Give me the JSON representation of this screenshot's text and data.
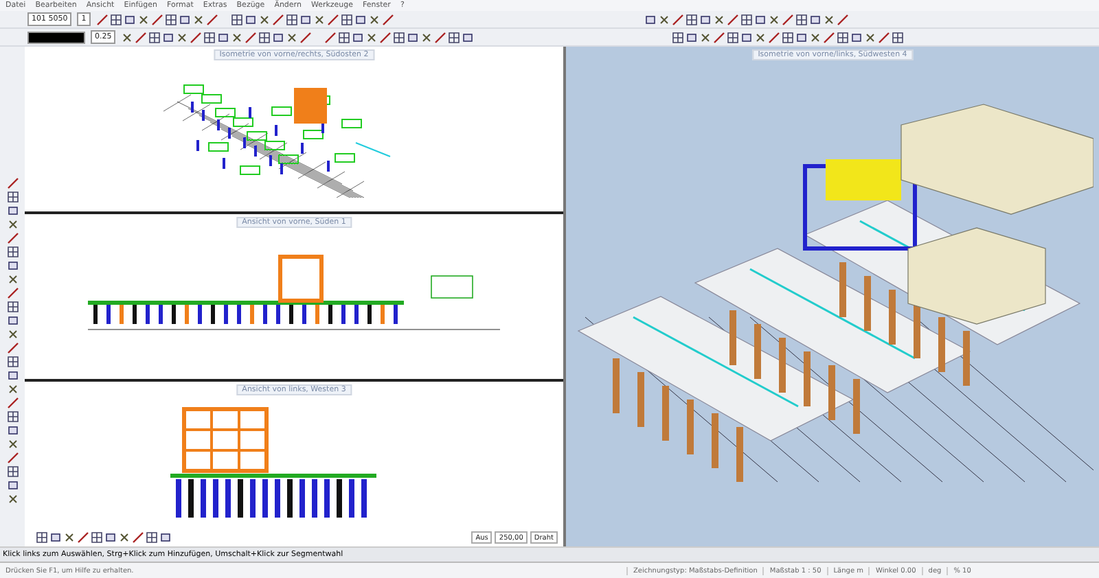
{
  "menu": [
    "Datei",
    "Bearbeiten",
    "Ansicht",
    "Einfügen",
    "Format",
    "Extras",
    "Bezüge",
    "Ändern",
    "Werkzeuge",
    "Fenster",
    "?"
  ],
  "toolbar": {
    "scale_field": "101 5050",
    "layer_field": "1",
    "line_weight_field": "0.25"
  },
  "viewports": [
    {
      "title": "Isometrie von vorne/rechts, Südosten 2",
      "kind": "iso"
    },
    {
      "title": "Ansicht von vorne, Süden 1",
      "kind": "front"
    },
    {
      "title": "Ansicht von links, Westen 3",
      "kind": "side"
    },
    {
      "title": "Isometrie von vorne/links, Südwesten 4",
      "kind": "render"
    }
  ],
  "view_controls": {
    "mode": "Aus",
    "value": "250,00",
    "render": "Draht"
  },
  "status": {
    "hint": "Klick links zum Auswählen, Strg+Klick zum Hinzufügen, Umschalt+Klick zur Segmentwahl",
    "help": "Drücken Sie F1, um Hilfe zu erhalten.",
    "drawing_type": "Zeichnungstyp: Maßstabs-Definition",
    "scale": "Maßstab  1 : 50",
    "length": "Länge  m",
    "angle": "Winkel  0.00",
    "unit": "deg",
    "zoom": "%  10"
  }
}
